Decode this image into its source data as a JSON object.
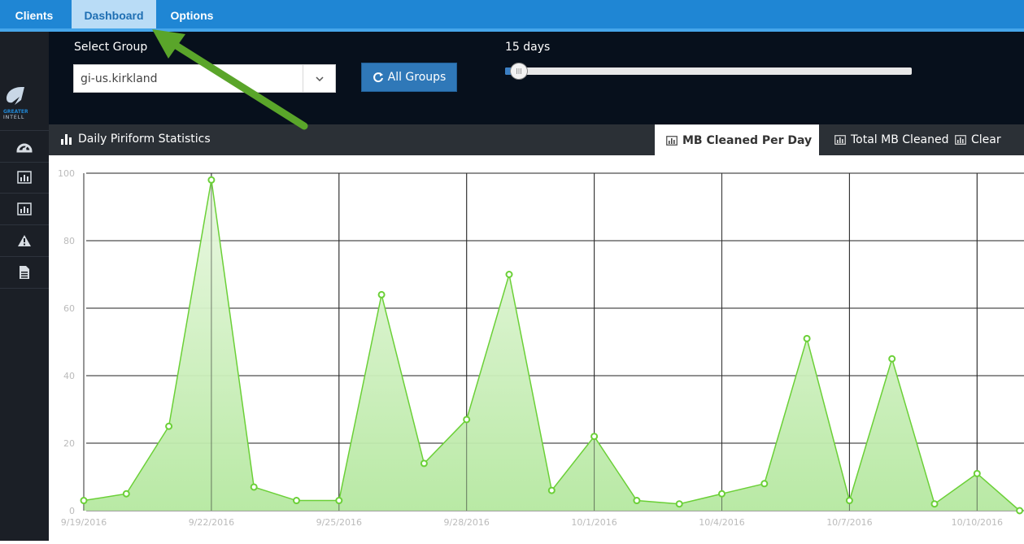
{
  "topnav": {
    "tabs": [
      {
        "label": "Clients",
        "active": false
      },
      {
        "label": "Dashboard",
        "active": true
      },
      {
        "label": "Options",
        "active": false
      }
    ]
  },
  "logo": {
    "text_line1": "GREATER",
    "text_line2": "INTELL"
  },
  "sidebar": {
    "icons": [
      "dashboard-icon",
      "bar-chart-icon",
      "bar-chart-icon",
      "warning-icon",
      "document-icon"
    ]
  },
  "controls": {
    "select_label": "Select Group",
    "select_value": "gi-us.kirkland",
    "all_groups_button": "All Groups",
    "days_label": "15 days",
    "slider_fraction": 0.03
  },
  "panel": {
    "title": "Daily Piriform Statistics",
    "tabs": [
      {
        "label": "MB Cleaned Per Day",
        "active": true
      },
      {
        "label": "Total MB Cleaned",
        "active": false
      },
      {
        "label": "Clear",
        "active": false
      }
    ]
  },
  "colors": {
    "topbar": "#1f86d4",
    "header": "#07101c",
    "series_line": "#6bd037",
    "series_fill": "#b5e8a0"
  },
  "annotation": {
    "type": "arrow",
    "color": "#5aa52a",
    "points_to": "Dashboard tab"
  },
  "chart_data": {
    "type": "area",
    "title": "",
    "ylim": [
      0,
      100
    ],
    "yticks": [
      0,
      20,
      40,
      60,
      80,
      100
    ],
    "xtick_labels": [
      "9/19/2016",
      "9/22/2016",
      "9/25/2016",
      "9/28/2016",
      "10/1/2016",
      "10/4/2016",
      "10/7/2016",
      "10/10/2016"
    ],
    "grid": true,
    "series": [
      {
        "values": [
          3,
          5,
          25,
          98,
          7,
          3,
          3,
          64,
          14,
          27,
          70,
          6,
          22,
          3,
          2,
          5,
          8,
          51,
          3,
          45,
          2,
          11,
          0
        ]
      }
    ]
  }
}
